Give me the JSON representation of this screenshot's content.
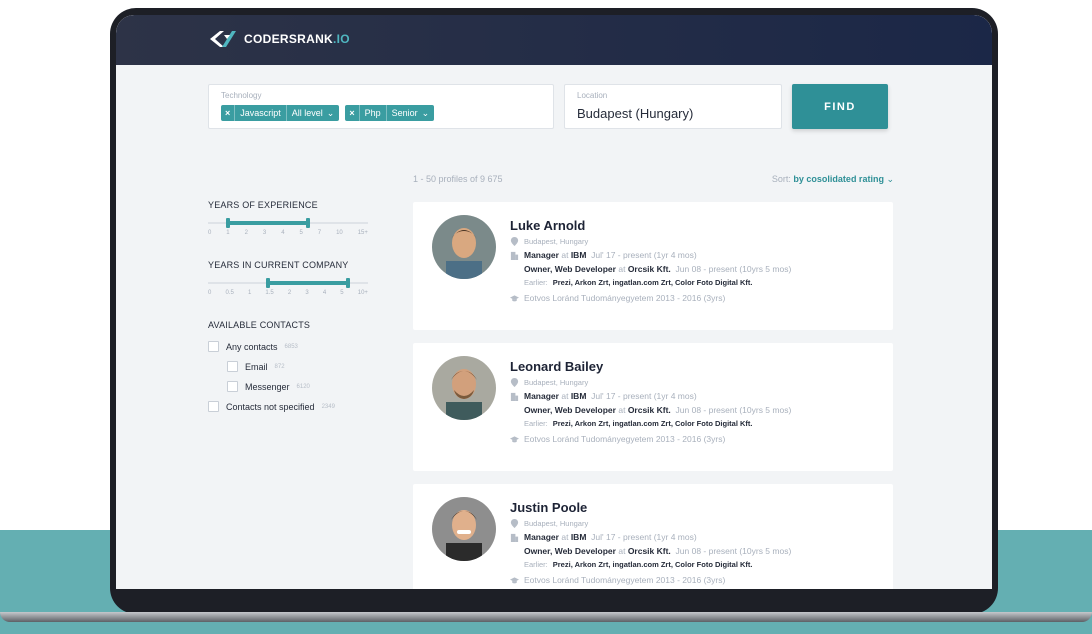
{
  "brand": {
    "name": "CODERSRANK",
    "tld": ".IO"
  },
  "search": {
    "technology_label": "Technology",
    "chips": [
      {
        "x": "×",
        "name": "Javascript",
        "level": "All level"
      },
      {
        "x": "×",
        "name": "Php",
        "level": "Senior"
      }
    ],
    "location_label": "Location",
    "location_value": "Budapest (Hungary)",
    "find_label": "FIND"
  },
  "results": {
    "count_text": "1 - 50  profiles of  9 675",
    "sort_label": "Sort:",
    "sort_value": "by cosolidated rating"
  },
  "filters": {
    "experience": {
      "title": "YEARS OF EXPERIENCE",
      "ticks": [
        "0",
        "1",
        "2",
        "3",
        "4",
        "5",
        "7",
        "10",
        "15+"
      ],
      "range": [
        1,
        5
      ]
    },
    "company": {
      "title": "YEARS IN CURRENT COMPANY",
      "ticks": [
        "0",
        "0.5",
        "1",
        "1.5",
        "2",
        "3",
        "4",
        "5",
        "10+"
      ],
      "range": [
        1.5,
        5
      ]
    },
    "contacts": {
      "title": "AVAILABLE CONTACTS",
      "items": [
        {
          "label": "Any contacts",
          "count": "6853",
          "sub": false
        },
        {
          "label": "Email",
          "count": "872",
          "sub": true
        },
        {
          "label": "Messenger",
          "count": "6120",
          "sub": true
        },
        {
          "label": "Contacts not specified",
          "count": "2349",
          "sub": false
        }
      ]
    }
  },
  "profiles": [
    {
      "name": "Luke Arnold",
      "location": "Budapest, Hungary",
      "role": "Manager",
      "at1": "at",
      "company": "IBM",
      "period": "Jul' 17 - present (1yr 4 mos)",
      "role2": "Owner, Web Developer",
      "at2": "at",
      "company2": "Orcsik Kft.",
      "period2": "Jun 08 - present  (10yrs 5 mos)",
      "earlier_label": "Earlier:",
      "earlier": "Prezi,  Arkon Zrt,  ingatlan.com Zrt,  Color Foto Digital Kft.",
      "education": "Eotvos Loránd Tudományegyetem  2013 - 2016  (3yrs)"
    },
    {
      "name": "Leonard Bailey",
      "location": "Budapest, Hungary",
      "role": "Manager",
      "at1": "at",
      "company": "IBM",
      "period": "Jul' 17 - present (1yr 4 mos)",
      "role2": "Owner, Web Developer",
      "at2": "at",
      "company2": "Orcsik Kft.",
      "period2": "Jun 08 - present  (10yrs 5 mos)",
      "earlier_label": "Earlier:",
      "earlier": "Prezi,  Arkon Zrt,  ingatlan.com Zrt,  Color Foto Digital Kft.",
      "education": "Eotvos Loránd Tudományegyetem  2013 - 2016  (3yrs)"
    },
    {
      "name": "Justin Poole",
      "location": "Budapest, Hungary",
      "role": "Manager",
      "at1": "at",
      "company": "IBM",
      "period": "Jul' 17 - present (1yr 4 mos)",
      "role2": "Owner, Web Developer",
      "at2": "at",
      "company2": "Orcsik Kft.",
      "period2": "Jun 08 - present  (10yrs 5 mos)",
      "earlier_label": "Earlier:",
      "earlier": "Prezi,  Arkon Zrt,  ingatlan.com Zrt,  Color Foto Digital Kft.",
      "education": "Eotvos Loránd Tudományegyetem  2013 - 2016  (3yrs)"
    }
  ],
  "colors": {
    "accent": "#2f9097",
    "chip": "#3a9da1",
    "header": "#1b2747",
    "band": "#64afb2"
  }
}
